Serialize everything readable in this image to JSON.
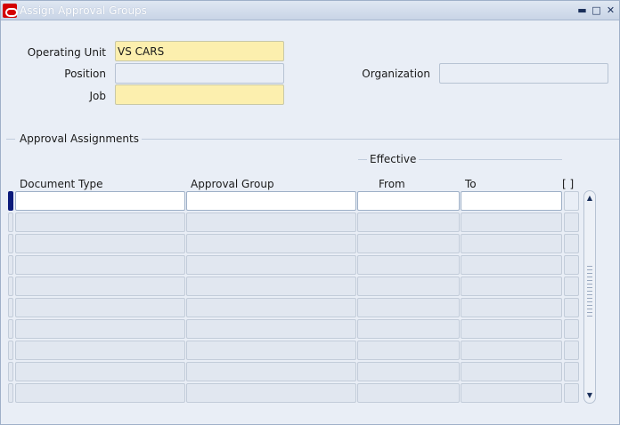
{
  "window": {
    "title": "Assign Approval Groups",
    "minimize": "▬",
    "maximize": "□",
    "close": "✕"
  },
  "header": {
    "operating_unit_label": "Operating Unit",
    "operating_unit_value": "VS CARS",
    "position_label": "Position",
    "position_value": "",
    "job_label": "Job",
    "job_value": "",
    "organization_label": "Organization",
    "organization_value": ""
  },
  "assignments": {
    "section_label": "Approval Assignments",
    "effective_label": "Effective",
    "columns": {
      "document_type": "Document Type",
      "approval_group": "Approval Group",
      "from": "From",
      "to": "To",
      "flex": "[ ]"
    },
    "rows": [
      {
        "document_type": "",
        "approval_group": "",
        "from": "",
        "to": ""
      },
      {
        "document_type": "",
        "approval_group": "",
        "from": "",
        "to": ""
      },
      {
        "document_type": "",
        "approval_group": "",
        "from": "",
        "to": ""
      },
      {
        "document_type": "",
        "approval_group": "",
        "from": "",
        "to": ""
      },
      {
        "document_type": "",
        "approval_group": "",
        "from": "",
        "to": ""
      },
      {
        "document_type": "",
        "approval_group": "",
        "from": "",
        "to": ""
      },
      {
        "document_type": "",
        "approval_group": "",
        "from": "",
        "to": ""
      },
      {
        "document_type": "",
        "approval_group": "",
        "from": "",
        "to": ""
      },
      {
        "document_type": "",
        "approval_group": "",
        "from": "",
        "to": ""
      },
      {
        "document_type": "",
        "approval_group": "",
        "from": "",
        "to": ""
      }
    ]
  },
  "scrollbar": {
    "up_icon": "▲",
    "down_icon": "▼"
  },
  "colors": {
    "required_field": "#fcefae",
    "background": "#e9eef6",
    "current_record": "#0b1a7a"
  }
}
